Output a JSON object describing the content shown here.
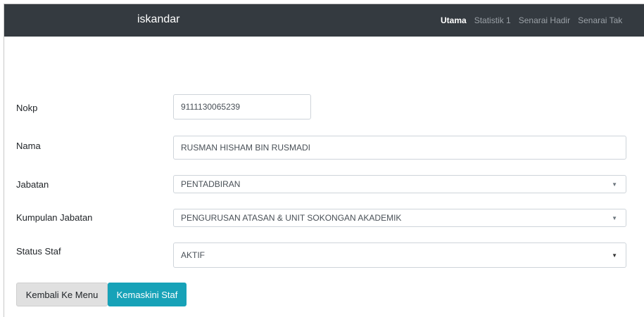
{
  "navbar": {
    "brand": "iskandar",
    "links": [
      {
        "label": "Utama",
        "active": true
      },
      {
        "label": "Statistik 1",
        "active": false
      },
      {
        "label": "Senarai Hadir",
        "active": false
      },
      {
        "label": "Senarai Tak",
        "active": false
      }
    ]
  },
  "form": {
    "nokp": {
      "label": "Nokp",
      "value": "9111130065239"
    },
    "nama": {
      "label": "Nama",
      "value": "RUSMAN HISHAM BIN RUSMADI"
    },
    "jabatan": {
      "label": "Jabatan",
      "value": "PENTADBIRAN"
    },
    "kumpulan": {
      "label": "Kumpulan Jabatan",
      "value": "PENGURUSAN ATASAN & UNIT SOKONGAN AKADEMIK"
    },
    "status": {
      "label": "Status Staf",
      "value": "AKTIF"
    }
  },
  "buttons": {
    "back": "Kembali Ke Menu",
    "update": "Kemaskini Staf"
  },
  "colors": {
    "navbar": "#343a40",
    "update_button": "#17a2b8"
  },
  "icons": {
    "select_caret": "caret-down-icon"
  }
}
